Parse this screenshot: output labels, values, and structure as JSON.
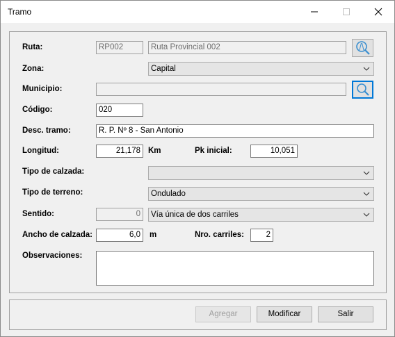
{
  "window": {
    "title": "Tramo"
  },
  "form": {
    "ruta": {
      "label": "Ruta:",
      "code": "RP002",
      "name": "Ruta Provincial 002"
    },
    "zona": {
      "label": "Zona:",
      "value": "Capital"
    },
    "municipio": {
      "label": "Municipio:",
      "value": ""
    },
    "codigo": {
      "label": "Código:",
      "value": "020"
    },
    "desc": {
      "label": "Desc. tramo:",
      "value": "R. P. Nº 8 - San Antonio"
    },
    "longitud": {
      "label": "Longitud:",
      "value": "21,178",
      "unit": "Km"
    },
    "pk": {
      "label": "Pk inicial:",
      "value": "10,051"
    },
    "calzada": {
      "label": "Tipo de calzada:",
      "value": ""
    },
    "terreno": {
      "label": "Tipo de terreno:",
      "value": "Ondulado"
    },
    "sentido": {
      "label": "Sentido:",
      "code": "0",
      "value": "Vía única de dos carriles"
    },
    "ancho": {
      "label": "Ancho de calzada:",
      "value": "6,0",
      "unit": "m"
    },
    "carriles": {
      "label": "Nro. carriles:",
      "value": "2"
    },
    "obs": {
      "label": "Observaciones:",
      "value": ""
    }
  },
  "buttons": {
    "agregar": "Agregar",
    "modificar": "Modificar",
    "salir": "Salir"
  }
}
